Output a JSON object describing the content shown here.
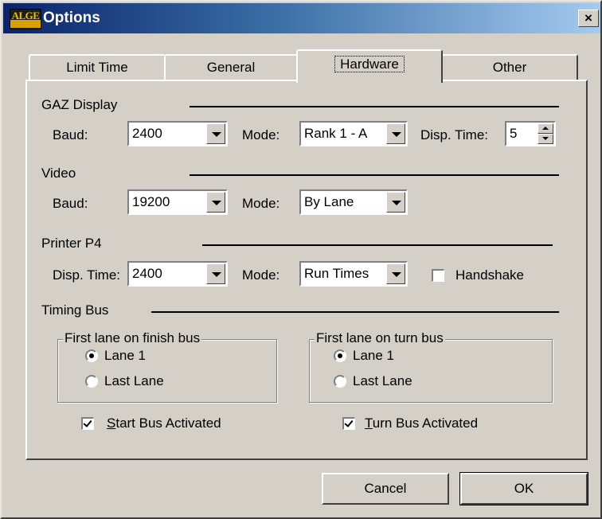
{
  "window": {
    "title": "Options",
    "logo_text": "ALGE",
    "close_symbol": "×"
  },
  "tabs": [
    {
      "label": "Limit Time",
      "active": false
    },
    {
      "label": "General",
      "active": false
    },
    {
      "label": "Hardware",
      "active": true
    },
    {
      "label": "Other",
      "active": false
    }
  ],
  "gaz": {
    "section_label": "GAZ Display",
    "baud_label": "Baud:",
    "baud_value": "2400",
    "mode_label": "Mode:",
    "mode_value": "Rank 1 - A",
    "disp_time_label": "Disp. Time:",
    "disp_time_value": "5"
  },
  "video": {
    "section_label": "Video",
    "baud_label": "Baud:",
    "baud_value": "19200",
    "mode_label": "Mode:",
    "mode_value": "By Lane"
  },
  "printer": {
    "section_label": "Printer P4",
    "disp_time_label": "Disp. Time:",
    "disp_time_value": "2400",
    "mode_label": "Mode:",
    "mode_value": "Run Times",
    "handshake_label": "Handshake",
    "handshake_checked": false
  },
  "timing_bus": {
    "section_label": "Timing Bus",
    "finish_group": {
      "title": "First lane on finish bus",
      "option1": "Lane 1",
      "option2": "Last Lane",
      "selected": "Lane 1"
    },
    "turn_group": {
      "title": "First lane on turn bus",
      "option1": "Lane 1",
      "option2": "Last Lane",
      "selected": "Lane 1"
    },
    "start_bus": {
      "mnemonic": "S",
      "rest": "tart Bus Activated",
      "checked": true
    },
    "turn_bus": {
      "mnemonic": "T",
      "rest": "urn Bus Activated",
      "checked": true
    }
  },
  "buttons": {
    "cancel": "Cancel",
    "ok": "OK"
  },
  "colors": {
    "face": "#d4d0c8",
    "title_start": "#0a246a",
    "title_end": "#a6caf0"
  }
}
